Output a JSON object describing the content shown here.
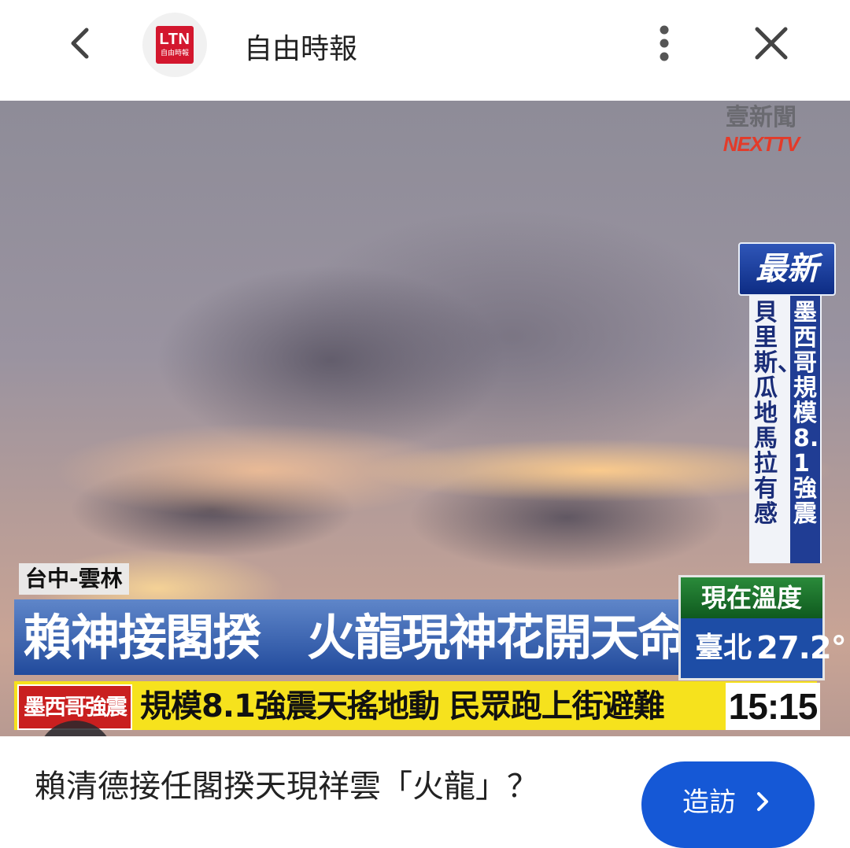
{
  "header": {
    "site_name": "自由時報",
    "logo_text": "LTN",
    "logo_subtext": "自由時報",
    "back_icon": "chevron-left-icon",
    "more_icon": "more-vertical-icon",
    "close_icon": "close-icon"
  },
  "image": {
    "tv_logo_top": "壹新聞",
    "tv_logo_bottom": "NEXTTV",
    "latest_badge": "最新",
    "vertical_news_1": "貝里斯、瓜地馬拉有感",
    "vertical_news_2": "墨西哥規模8.1強震",
    "location": "台中-雲林",
    "headline": "賴神接閣揆　火龍現神花開天命所歸?",
    "temperature_label": "現在溫度",
    "temperature_city": "臺北",
    "temperature_value": "27.2°",
    "ticker_tag": "墨西哥強震",
    "ticker_text": "規模8.1強震天搖地動 民眾跑上街避難",
    "clock": "15:15",
    "lens_icon": "camera-lens-icon"
  },
  "caption": {
    "title": "賴清德接任閣揆天現祥雲「火龍」？",
    "visit_label": "造訪",
    "visit_icon": "chevron-right-icon"
  },
  "colors": {
    "accent": "#1558d6",
    "logo_red": "#d3172e",
    "ticker_yellow": "#f6e21d"
  }
}
